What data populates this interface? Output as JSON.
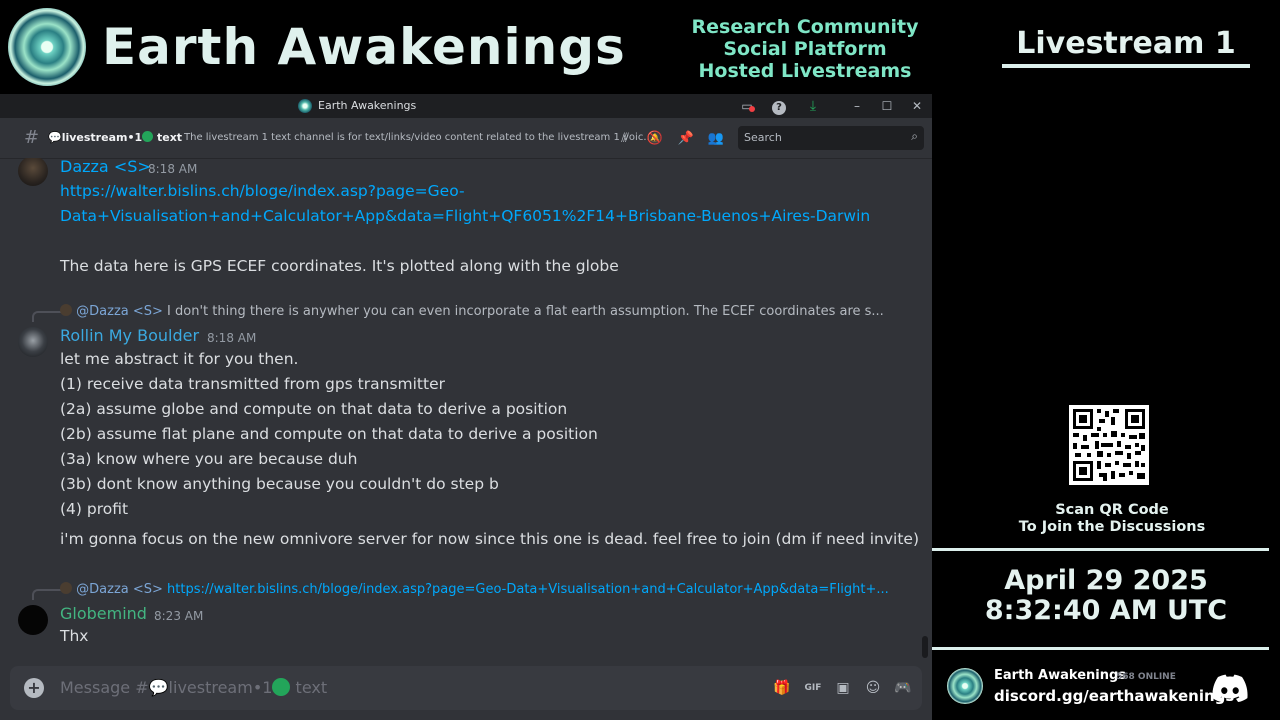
{
  "header": {
    "brand": "Earth Awakenings",
    "promo": [
      "Research Community",
      "Social Platform",
      "Hosted Livestreams"
    ],
    "livestream_title": "Livestream 1"
  },
  "window": {
    "title": "Earth Awakenings",
    "controls": [
      "screen-share-icon",
      "help-icon",
      "download-icon",
      "minimize-icon",
      "maximize-icon",
      "close-icon"
    ]
  },
  "channel": {
    "hash": "#",
    "name_prefix": "livestream",
    "name_sep": "•1",
    "name_suffix": "text",
    "topic": "The livestream 1 text channel is for text/links/video content related to the livestream 1 voic...",
    "search_placeholder": "Search"
  },
  "messages": [
    {
      "author": "Dazza <S>",
      "author_color": "#00a8fc",
      "time": "8:18 AM",
      "link_line1": "https://walter.bislins.ch/bloge/index.asp?page=Geo-",
      "link_line2": "Data+Visualisation+and+Calculator+App&data=Flight+QF6051%2F14+Brisbane-Buenos+Aires-Darwin",
      "text": "The data here is GPS ECEF coordinates. It's plotted along with the globe"
    },
    {
      "reply_to": "@Dazza <S>",
      "reply_text": "I don't thing there is anywher you can even incorporate a flat earth assumption. The ECEF coordinates are s...",
      "author": "Rollin My Boulder",
      "author_color": "#3ba9e0",
      "time": "8:18 AM",
      "lines": [
        "let me abstract it for you then.",
        "(1) receive data transmitted from gps transmitter",
        "(2a) assume globe and compute on that data to derive a position",
        "(2b) assume flat plane and compute on that data to derive a position",
        "(3a) know where you are because duh",
        "(3b) dont know anything because you couldn't do step b",
        "(4) profit"
      ],
      "followup": "i'm gonna focus on the new omnivore server for now since this one is dead. feel free to join (dm if need invite)"
    },
    {
      "reply_to": "@Dazza <S>",
      "reply_text": "https://walter.bislins.ch/bloge/index.asp?page=Geo-Data+Visualisation+and+Calculator+App&data=Flight+...",
      "author": "Globemind",
      "author_color": "#43b581",
      "time": "8:23 AM",
      "text": "Thx"
    }
  ],
  "composer": {
    "placeholder_prefix": "Message #",
    "placeholder_channel": "livestream",
    "placeholder_sep": "•1",
    "placeholder_suffix": "text",
    "icons": [
      "gift-icon",
      "gif-icon",
      "sticker-icon",
      "emoji-icon",
      "activities-icon"
    ]
  },
  "sidebar": {
    "qr_caption_line1": "Scan QR Code",
    "qr_caption_line2": "To Join the Discussions",
    "date": "April 29 2025",
    "time": "8:32:40 AM UTC",
    "server_name": "Earth Awakenings",
    "online_count": "568 ONLINE",
    "invite": "discord.gg/earthawakenings"
  }
}
